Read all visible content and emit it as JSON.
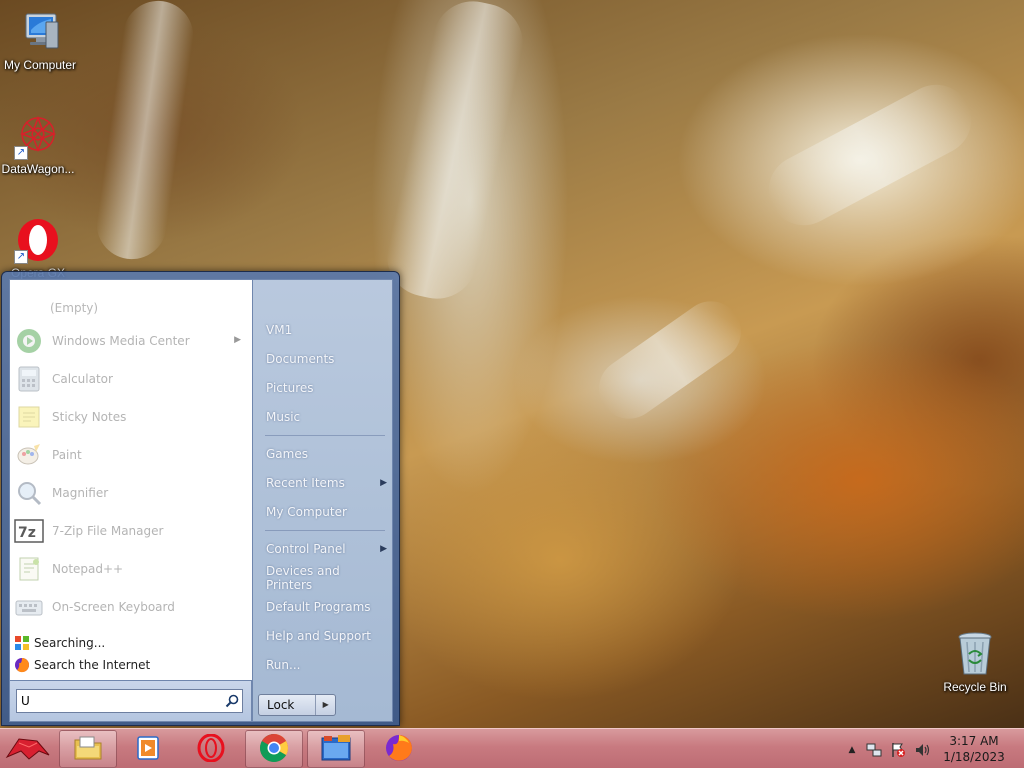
{
  "desktop": {
    "icons": [
      {
        "label": "My Computer",
        "icon": "computer-icon"
      },
      {
        "label": "DataWagon...",
        "icon": "datawagon-icon"
      },
      {
        "label": "Opera GX",
        "icon": "opera-gx-icon"
      },
      {
        "label": "Recycle Bin",
        "icon": "recycle-bin-icon"
      }
    ]
  },
  "start_menu": {
    "empty_label": "(Empty)",
    "programs": [
      {
        "label": "Windows Media Center",
        "icon": "windows-media-center-icon",
        "has_submenu": true
      },
      {
        "label": "Calculator",
        "icon": "calculator-icon",
        "has_submenu": false
      },
      {
        "label": "Sticky Notes",
        "icon": "sticky-notes-icon",
        "has_submenu": false
      },
      {
        "label": "Paint",
        "icon": "paint-icon",
        "has_submenu": false
      },
      {
        "label": "Magnifier",
        "icon": "magnifier-icon",
        "has_submenu": false
      },
      {
        "label": "7-Zip File Manager",
        "icon": "7zip-icon",
        "has_submenu": false
      },
      {
        "label": "Notepad++",
        "icon": "notepad-plus-plus-icon",
        "has_submenu": false
      },
      {
        "label": "On-Screen Keyboard",
        "icon": "keyboard-icon",
        "has_submenu": false
      }
    ],
    "search_results": [
      {
        "label": "Searching...",
        "icon": "windows-search-icon"
      },
      {
        "label": "Search the Internet",
        "icon": "firefox-icon"
      }
    ],
    "search": {
      "value": "U",
      "placeholder": ""
    },
    "right_items": [
      {
        "label": "VM1",
        "has_submenu": false
      },
      {
        "label": "Documents",
        "has_submenu": false
      },
      {
        "label": "Pictures",
        "has_submenu": false
      },
      {
        "label": "Music",
        "has_submenu": false
      },
      {
        "label": "Games",
        "has_submenu": false
      },
      {
        "label": "Recent Items",
        "has_submenu": true
      },
      {
        "label": "My Computer",
        "has_submenu": false
      },
      {
        "label": "Control Panel",
        "has_submenu": true
      },
      {
        "label": "Devices and Printers",
        "has_submenu": false
      },
      {
        "label": "Default Programs",
        "has_submenu": false
      },
      {
        "label": "Help and Support",
        "has_submenu": false
      },
      {
        "label": "Run...",
        "has_submenu": false
      }
    ],
    "lock_label": "Lock"
  },
  "taskbar": {
    "buttons": [
      {
        "icon": "start-orb-icon",
        "open": false
      },
      {
        "icon": "file-explorer-icon",
        "open": true
      },
      {
        "icon": "media-player-icon",
        "open": false
      },
      {
        "icon": "opera-gx-icon",
        "open": false
      },
      {
        "icon": "chrome-icon",
        "open": true
      },
      {
        "icon": "file-manager-icon",
        "open": true
      },
      {
        "icon": "firefox-icon",
        "open": false
      }
    ],
    "tray": {
      "icons": [
        "show-hidden-icons-chevron",
        "network-icon",
        "action-center-flag-icon",
        "volume-icon"
      ],
      "time": "3:17 AM",
      "date": "1/18/2023"
    }
  },
  "colors": {
    "taskbar": "#c87a80",
    "start_menu_frame": "#4f6fa0",
    "accent_blue": "#1a56c8"
  }
}
